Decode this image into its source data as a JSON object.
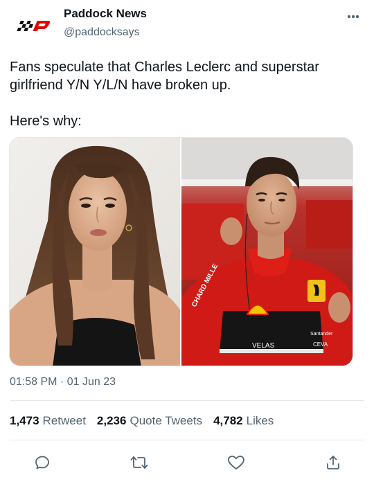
{
  "tweet": {
    "author_name": "Paddock News",
    "author_handle": "@paddocksays",
    "text": "Fans speculate that Charles Leclerc and superstar girlfriend Y/N Y/L/N have broken up.\n\nHere's why:",
    "timestamp": "01:58 PM · 01 Jun 23",
    "media": {
      "left_image": "woman-portrait-photo",
      "right_image": "racing-driver-photo",
      "right_image_text": [
        "CHARD MILLE",
        "VELAS",
        "Santander",
        "CEVA",
        "Ferrari"
      ]
    }
  },
  "stats": {
    "retweets": {
      "count": "1,473",
      "label": "Retweet"
    },
    "quotes": {
      "count": "2,236",
      "label": "Quote Tweets"
    },
    "likes": {
      "count": "4,782",
      "label": "Likes"
    }
  },
  "actions": [
    {
      "name": "reply",
      "icon": "comment-icon"
    },
    {
      "name": "retweet",
      "icon": "retweet-icon"
    },
    {
      "name": "like",
      "icon": "heart-icon"
    },
    {
      "name": "share",
      "icon": "share-icon"
    }
  ],
  "colors": {
    "text_primary": "#0f1419",
    "text_secondary": "#536471",
    "divider": "#e6e9ec",
    "logo_red": "#e10600",
    "ferrari_red": "#d40000"
  }
}
